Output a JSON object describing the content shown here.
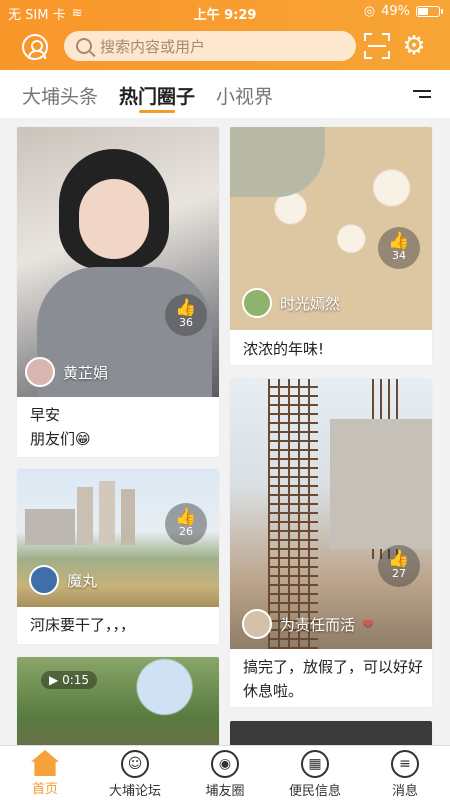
{
  "status": {
    "carrier": "无 SIM 卡",
    "time": "上午 9:29",
    "battery": "49%"
  },
  "search": {
    "placeholder": "搜索内容或用户"
  },
  "tabs": [
    {
      "label": "大埔头条"
    },
    {
      "label": "热门圈子"
    },
    {
      "label": "小视界"
    }
  ],
  "posts": [
    {
      "author": "黄芷娟",
      "likes": "36",
      "line1": "早安",
      "line2": "朋友们😁"
    },
    {
      "author": "时光嫣然",
      "likes": "34",
      "line1": "浓浓的年味!"
    },
    {
      "author": "魔丸",
      "likes": "26",
      "line1": "河床要干了，，，"
    },
    {
      "author": "为责任而活",
      "likes": "27",
      "line1": "搞完了，放假了，可以好好",
      "line2": "休息啦。"
    },
    {
      "duration": "0:15"
    }
  ],
  "bottom_nav": [
    {
      "label": "首页"
    },
    {
      "label": "大埔论坛"
    },
    {
      "label": "埔友圈"
    },
    {
      "label": "便民信息"
    },
    {
      "label": "消息"
    }
  ],
  "colors": {
    "accent": "#f39c2a",
    "header": "#f9962a"
  }
}
